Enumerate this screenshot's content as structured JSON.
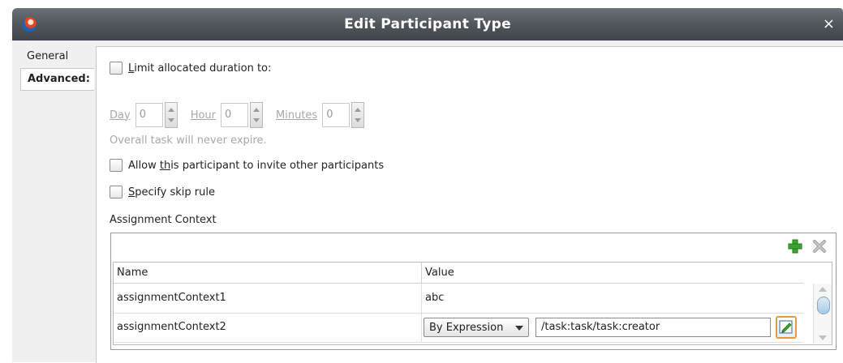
{
  "window": {
    "title": "Edit Participant Type",
    "close_glyph": "×"
  },
  "tabs": [
    {
      "label": "General"
    },
    {
      "label": "Advanced:"
    }
  ],
  "limit_duration": {
    "label_prefix": "",
    "mnemonic": "L",
    "label_rest": "imit allocated duration to:",
    "checked": false
  },
  "duration": {
    "day": {
      "mnemonic": "D",
      "rest": "ay",
      "value": "0"
    },
    "hour": {
      "mnemonic": "H",
      "rest": "our",
      "value": "0"
    },
    "minutes": {
      "mnemonic": "M",
      "rest": "inutes",
      "value": "0"
    }
  },
  "expiry_hint": "Overall task will never expire.",
  "allow_invite": {
    "prefix": "Allow ",
    "mnemonic": "th",
    "rest": "is participant to invite other participants",
    "checked": false
  },
  "skip_rule": {
    "mnemonic": "S",
    "rest": "pecify skip rule",
    "checked": false
  },
  "assignment_context": {
    "section_label": "Assignment Context",
    "columns": [
      "Name",
      "Value"
    ],
    "rows": [
      {
        "name": "assignmentContext1",
        "value": "abc"
      },
      {
        "name": "assignmentContext2",
        "value_type": "By Expression",
        "expression": "/task:task/task:creator"
      }
    ]
  },
  "icons": {
    "add": "plus-icon",
    "delete": "x-icon",
    "edit": "edit-expression-icon",
    "logo": "app-logo-icon"
  },
  "colors": {
    "titlebar": "#4f545a",
    "add_green": "#3aa52c",
    "edit_border": "#e89a3a"
  }
}
